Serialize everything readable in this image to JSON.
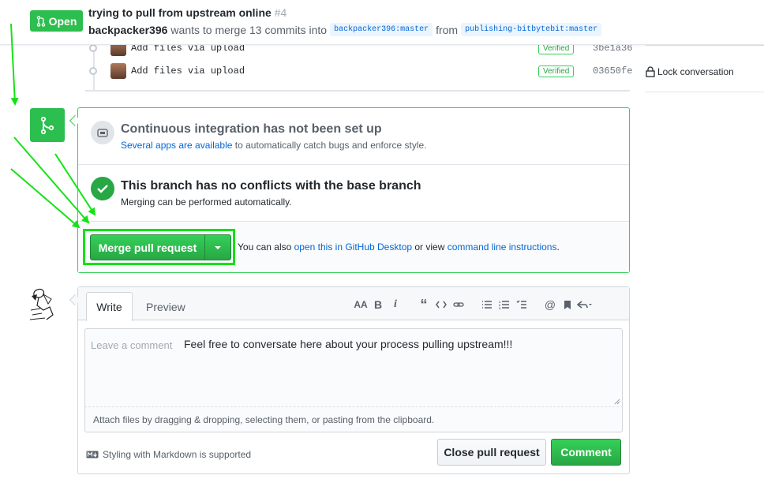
{
  "header": {
    "status": "Open",
    "title": "trying to pull from upstream online",
    "number": "#4",
    "author": "backpacker396",
    "meta_text": "wants to merge 13 commits into",
    "base_branch": "backpacker396:master",
    "from_text": "from",
    "head_branch": "publishing-bitbytebit:master"
  },
  "commits": [
    {
      "message": "Add files via upload",
      "verified": "Verified",
      "sha": "3be1a36"
    },
    {
      "message": "Add files via upload",
      "verified": "Verified",
      "sha": "03650fe"
    }
  ],
  "sidebar": {
    "lock": "Lock conversation"
  },
  "merge": {
    "ci_title": "Continuous integration has not been set up",
    "ci_link": "Several apps are available",
    "ci_rest": " to automatically catch bugs and enforce style.",
    "nc_title": "This branch has no conflicts with the base branch",
    "nc_sub": "Merging can be performed automatically.",
    "button": "Merge pull request",
    "also_prefix": "You can also ",
    "desktop_link": "open this in GitHub Desktop",
    "also_mid": " or view ",
    "cli_link": "command line instructions",
    "also_suffix": "."
  },
  "comment": {
    "tab_write": "Write",
    "tab_preview": "Preview",
    "placeholder": "Leave a comment",
    "typed_text": "Feel free to conversate here about your process pulling upstream!!!",
    "attach_hint": "Attach files by dragging & dropping, selecting them, or pasting from the clipboard.",
    "markdown_note": "Styling with Markdown is supported",
    "close_button": "Close pull request",
    "comment_button": "Comment"
  },
  "colors": {
    "green": "#2cbe4e",
    "link": "#0366d6",
    "highlight": "#15e215"
  }
}
